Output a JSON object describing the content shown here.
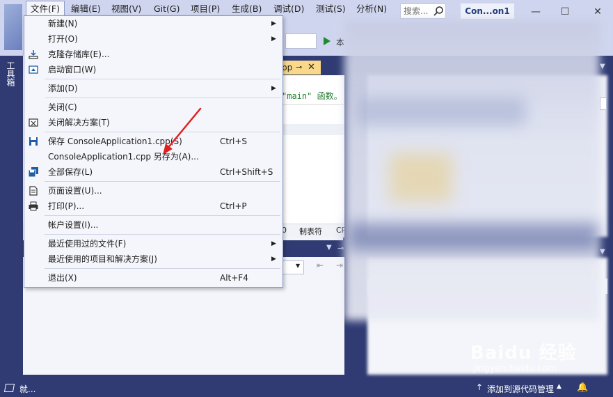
{
  "menubar": {
    "items": [
      "文件(F)",
      "编辑(E)",
      "视图(V)",
      "Git(G)",
      "项目(P)",
      "生成(B)",
      "调试(D)",
      "测试(S)",
      "分析(N)"
    ],
    "search_placeholder": "搜索...",
    "solution_name": "Con...on1"
  },
  "toolbar": {
    "run_label": "本"
  },
  "toolbox": {
    "label": "工具箱"
  },
  "editor": {
    "tab_label": "pp",
    "tab_pin": "⊸",
    "tab_close": "✕",
    "code_text": "\"main\" 函数。",
    "status_col": "0",
    "status_tabs": "制表符",
    "status_crlf": "CR"
  },
  "file_menu": {
    "items": [
      {
        "label": "新建(N)",
        "shortcut": "",
        "submenu": true,
        "icon": ""
      },
      {
        "label": "打开(O)",
        "shortcut": "",
        "submenu": true,
        "icon": ""
      },
      {
        "label": "克隆存储库(E)...",
        "shortcut": "",
        "submenu": false,
        "icon": "clone-icon"
      },
      {
        "label": "启动窗口(W)",
        "shortcut": "",
        "submenu": false,
        "icon": "start-window-icon"
      },
      {
        "label": "添加(D)",
        "shortcut": "",
        "submenu": true,
        "icon": ""
      },
      {
        "label": "关闭(C)",
        "shortcut": "",
        "submenu": false,
        "icon": ""
      },
      {
        "label": "关闭解决方案(T)",
        "shortcut": "",
        "submenu": false,
        "icon": "close-solution-icon"
      },
      {
        "label": "保存 ConsoleApplication1.cpp(S)",
        "shortcut": "Ctrl+S",
        "submenu": false,
        "icon": "save-icon"
      },
      {
        "label": "ConsoleApplication1.cpp 另存为(A)...",
        "shortcut": "",
        "submenu": false,
        "icon": ""
      },
      {
        "label": "全部保存(L)",
        "shortcut": "Ctrl+Shift+S",
        "submenu": false,
        "icon": "save-all-icon"
      },
      {
        "label": "页面设置(U)...",
        "shortcut": "",
        "submenu": false,
        "icon": "page-setup-icon"
      },
      {
        "label": "打印(P)...",
        "shortcut": "Ctrl+P",
        "submenu": false,
        "icon": "print-icon"
      },
      {
        "label": "帐户设置(I)...",
        "shortcut": "",
        "submenu": false,
        "icon": ""
      },
      {
        "label": "最近使用过的文件(F)",
        "shortcut": "",
        "submenu": true,
        "icon": ""
      },
      {
        "label": "最近使用的项目和解决方案(J)",
        "shortcut": "",
        "submenu": true,
        "icon": ""
      },
      {
        "label": "退出(X)",
        "shortcut": "Alt+F4",
        "submenu": false,
        "icon": ""
      }
    ]
  },
  "statusbar": {
    "status_text": "就...",
    "source_control": "添加到源代码管理"
  },
  "watermark": {
    "brand": "Baidu 经验",
    "url": "jingyan.baidu.com"
  },
  "colors": {
    "chrome": "#cfd5ee",
    "dark_frame": "#2f3b72",
    "menu_bg": "#f5f6fb",
    "annotation_arrow": "#e02020",
    "run_green": "#1f8a34"
  }
}
